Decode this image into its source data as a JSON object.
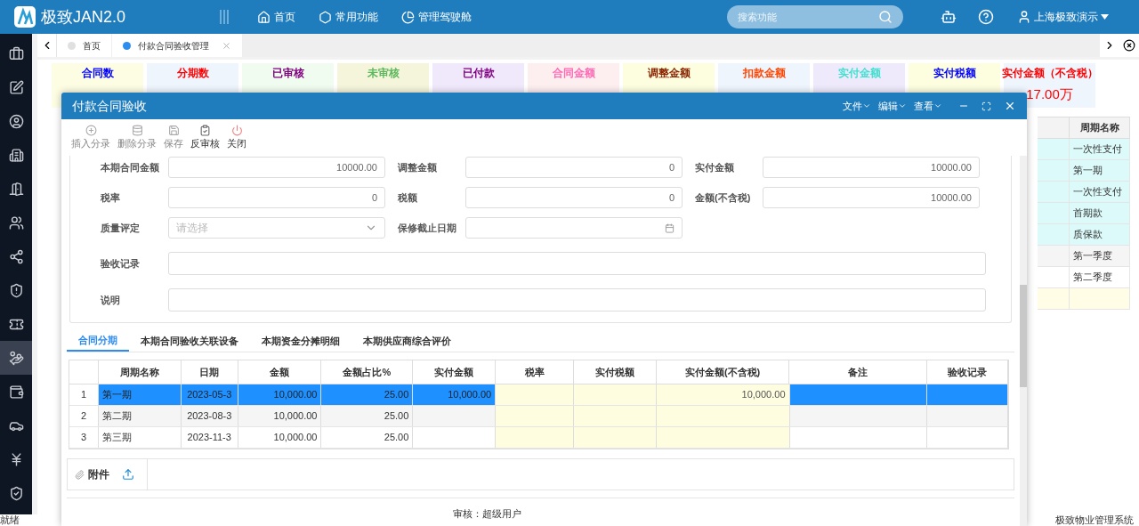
{
  "app": {
    "title": "极致JAN2.0"
  },
  "nav": [
    {
      "label": "首页",
      "kind": "home"
    },
    {
      "label": "常用功能",
      "kind": "hub"
    },
    {
      "label": "管理驾驶舱",
      "kind": "chart"
    }
  ],
  "search": {
    "placeholder": "搜索功能"
  },
  "user": {
    "name": "上海极致演示"
  },
  "sidebar": [
    {
      "kind": "briefcase",
      "selected": false
    },
    {
      "kind": "edit",
      "selected": false
    },
    {
      "kind": "user",
      "selected": false
    },
    {
      "kind": "building",
      "selected": false
    },
    {
      "kind": "door",
      "selected": false
    },
    {
      "kind": "users",
      "selected": false
    },
    {
      "kind": "share",
      "selected": false
    },
    {
      "kind": "download",
      "selected": false
    },
    {
      "kind": "ticket",
      "selected": false
    },
    {
      "kind": "money",
      "selected": true
    },
    {
      "kind": "wallet",
      "selected": false
    },
    {
      "kind": "car",
      "selected": false
    },
    {
      "kind": "yen",
      "selected": false
    },
    {
      "kind": "shield",
      "selected": false
    }
  ],
  "page_tabs": [
    {
      "label": "首页",
      "selected": false,
      "closable": false
    },
    {
      "label": "付款合同验收管理",
      "selected": true,
      "closable": true
    }
  ],
  "stats": [
    {
      "label": "合同数",
      "color": "#0000ff"
    },
    {
      "label": "分期数",
      "color": "#ff0000"
    },
    {
      "label": "已审核",
      "color": "#800080"
    },
    {
      "label": "未审核",
      "color": "#5cb85c"
    },
    {
      "label": "已付款",
      "color": "#800080"
    },
    {
      "label": "合同金额",
      "color": "#ff69b4"
    },
    {
      "label": "调整金额",
      "color": "#8b2500"
    },
    {
      "label": "扣款金额",
      "color": "#ff4500"
    },
    {
      "label": "实付金额",
      "color": "#40e0d0"
    },
    {
      "label": "实付税额",
      "color": "#0000ff"
    },
    {
      "label": "实付金额（不含税）",
      "value": "17.00万",
      "color": "#ff0000"
    }
  ],
  "background_table": {
    "columns": [
      "",
      "周期名称"
    ],
    "rows": [
      {
        "cells": [
          "",
          "一次性支付"
        ],
        "color": "#dcfafa"
      },
      {
        "cells": [
          "",
          "第一期"
        ],
        "color": "#dcfafa"
      },
      {
        "cells": [
          "",
          "一次性支付"
        ],
        "color": "#dcfafa"
      },
      {
        "cells": [
          "",
          "首期款"
        ],
        "color": "#dcfafa"
      },
      {
        "cells": [
          "",
          "质保款"
        ],
        "color": "#dcfafa"
      },
      {
        "cells": [
          "",
          "第一季度"
        ],
        "color": "#f5f5f5"
      },
      {
        "cells": [
          "",
          "第二季度"
        ],
        "color": "#ffffff"
      },
      {
        "cells": [
          "",
          ""
        ],
        "color": "#fffde6"
      }
    ]
  },
  "status_bar": {
    "left": "就绪",
    "right": "极致物业管理系统"
  },
  "dialog": {
    "title": "付款合同验收",
    "menus": [
      "文件",
      "编辑",
      "查看"
    ],
    "toolbar": [
      {
        "label": "插入分录",
        "kind": "insert",
        "disabled": true
      },
      {
        "label": "删除分录",
        "kind": "delete",
        "disabled": true
      },
      {
        "label": "保存",
        "kind": "save",
        "disabled": true
      },
      {
        "label": "反审核",
        "kind": "unaudit",
        "disabled": false
      },
      {
        "label": "关闭",
        "kind": "close",
        "disabled": false
      }
    ],
    "form_rows": [
      [
        {
          "label": "本期合同金额",
          "kind": "number",
          "value": "10000.00"
        },
        {
          "label": "调整金额",
          "kind": "number",
          "value": "0"
        },
        {
          "label": "实付金额",
          "kind": "number",
          "value": "10000.00"
        }
      ],
      [
        {
          "label": "税率",
          "kind": "number",
          "value": "0"
        },
        {
          "label": "税额",
          "kind": "number",
          "value": "0"
        },
        {
          "label": "金额(不含税)",
          "kind": "number",
          "value": "10000.00"
        }
      ],
      [
        {
          "label": "质量评定",
          "kind": "select",
          "placeholder": "请选择"
        },
        {
          "label": "保修截止日期",
          "kind": "date"
        }
      ],
      [
        {
          "label": "验收记录",
          "kind": "textarea"
        }
      ],
      [
        {
          "label": "说明",
          "kind": "textarea"
        }
      ]
    ],
    "tabs": [
      {
        "label": "合同分期",
        "selected": true
      },
      {
        "label": "本期合同验收关联设备",
        "selected": false
      },
      {
        "label": "本期资金分摊明细",
        "selected": false
      },
      {
        "label": "本期供应商综合评价",
        "selected": false
      }
    ],
    "grid": {
      "columns": [
        {
          "label": "周期名称",
          "editable": false
        },
        {
          "label": "日期",
          "editable": false
        },
        {
          "label": "金额",
          "editable": false
        },
        {
          "label": "金额占比%",
          "editable": false
        },
        {
          "label": "实付金额",
          "editable": false
        },
        {
          "label": "税率",
          "editable": true
        },
        {
          "label": "实付税额",
          "editable": true
        },
        {
          "label": "实付金额(不含税)",
          "editable": true
        },
        {
          "label": "备注",
          "editable": false
        },
        {
          "label": "验收记录",
          "editable": false
        }
      ],
      "rows": [
        {
          "index": "1",
          "selected": true,
          "cells": [
            "第一期",
            "2023-05-3",
            "10,000.00",
            "25.00",
            "10,000.00",
            "",
            "",
            "10,000.00",
            "",
            ""
          ]
        },
        {
          "index": "2",
          "selected": false,
          "cells": [
            "第二期",
            "2023-08-3",
            "10,000.00",
            "25.00",
            "",
            "",
            "",
            "",
            "",
            ""
          ]
        },
        {
          "index": "3",
          "selected": false,
          "cells": [
            "第三期",
            "2023-11-3",
            "10,000.00",
            "25.00",
            "",
            "",
            "",
            "",
            "",
            ""
          ]
        }
      ]
    },
    "attachment": {
      "label": "附件"
    },
    "footer": "审核：超级用户"
  }
}
